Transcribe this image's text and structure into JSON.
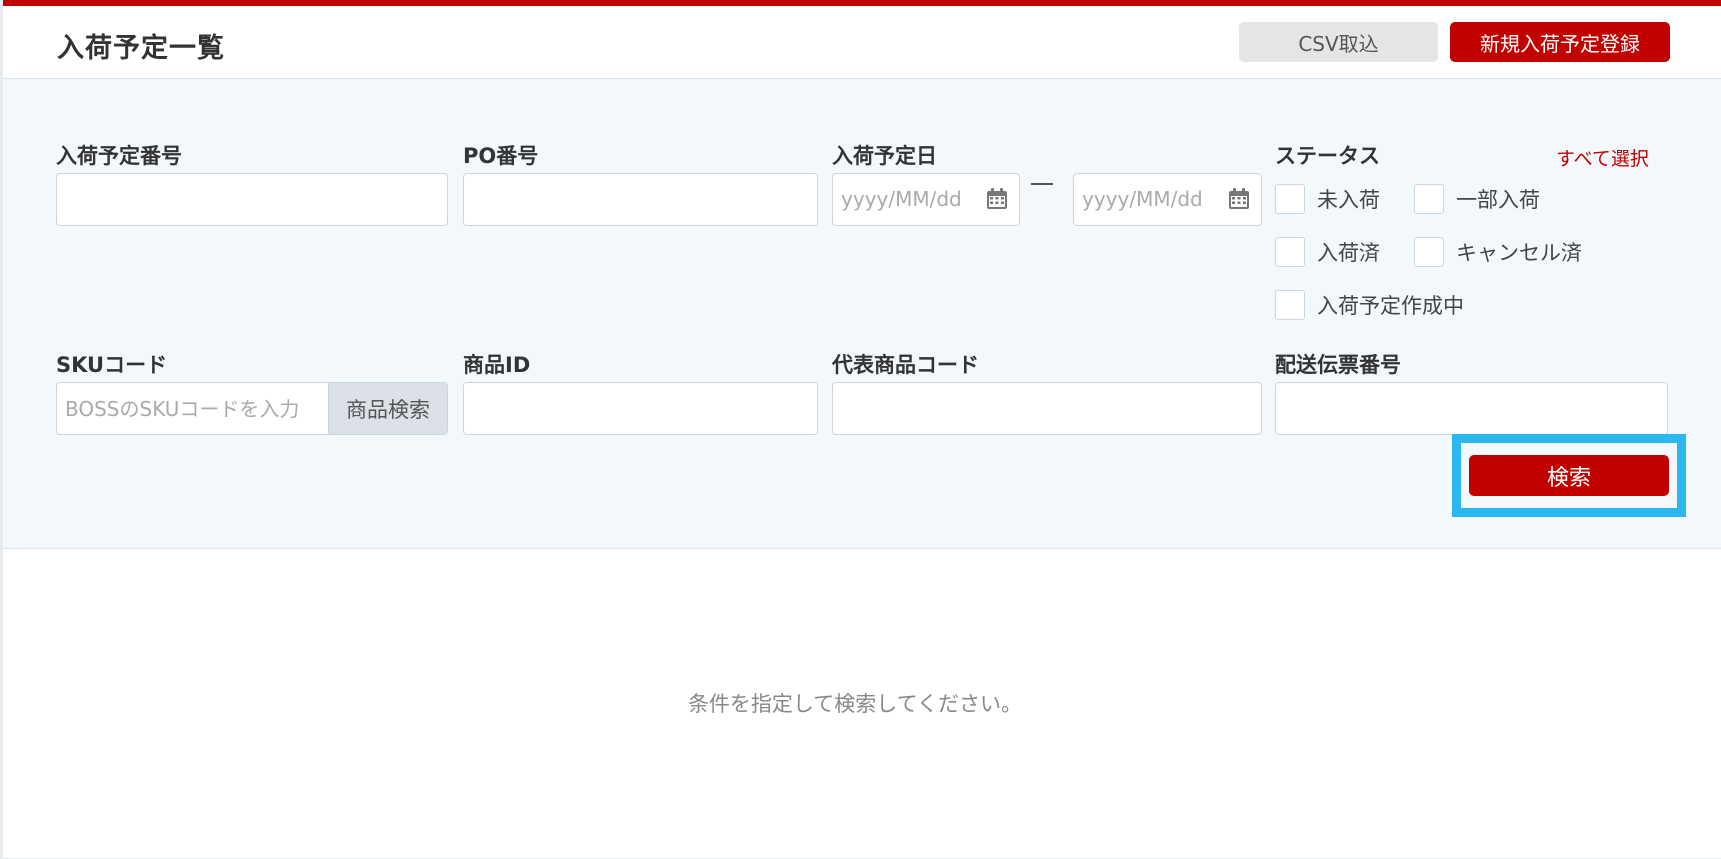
{
  "header": {
    "title": "入荷予定一覧",
    "csv_import_label": "CSV取込",
    "new_register_label": "新規入荷予定登録"
  },
  "filters": {
    "arrival_number": {
      "label": "入荷予定番号",
      "value": "",
      "placeholder": ""
    },
    "po_number": {
      "label": "PO番号",
      "value": "",
      "placeholder": ""
    },
    "arrival_date": {
      "label": "入荷予定日",
      "from_placeholder": "yyyy/MM/dd",
      "to_placeholder": "yyyy/MM/dd"
    },
    "status": {
      "label": "ステータス",
      "select_all": "すべて選択",
      "options": [
        {
          "label": "未入荷",
          "checked": false
        },
        {
          "label": "一部入荷",
          "checked": false
        },
        {
          "label": "入荷済",
          "checked": false
        },
        {
          "label": "キャンセル済",
          "checked": false
        },
        {
          "label": "入荷予定作成中",
          "checked": false
        }
      ]
    },
    "sku_code": {
      "label": "SKUコード",
      "placeholder": "BOSSのSKUコードを入力",
      "search_button": "商品検索"
    },
    "product_id": {
      "label": "商品ID",
      "value": "",
      "placeholder": ""
    },
    "representative_code": {
      "label": "代表商品コード",
      "value": "",
      "placeholder": ""
    },
    "delivery_slip": {
      "label": "配送伝票番号",
      "value": "",
      "placeholder": ""
    },
    "search_button": "検索"
  },
  "results": {
    "empty_message": "条件を指定して検索してください。"
  },
  "colors": {
    "brand_red": "#c10000",
    "panel_bg": "#f3f8fc",
    "highlight": "#2bb8f0"
  },
  "icons": {
    "calendar": "calendar-icon"
  }
}
